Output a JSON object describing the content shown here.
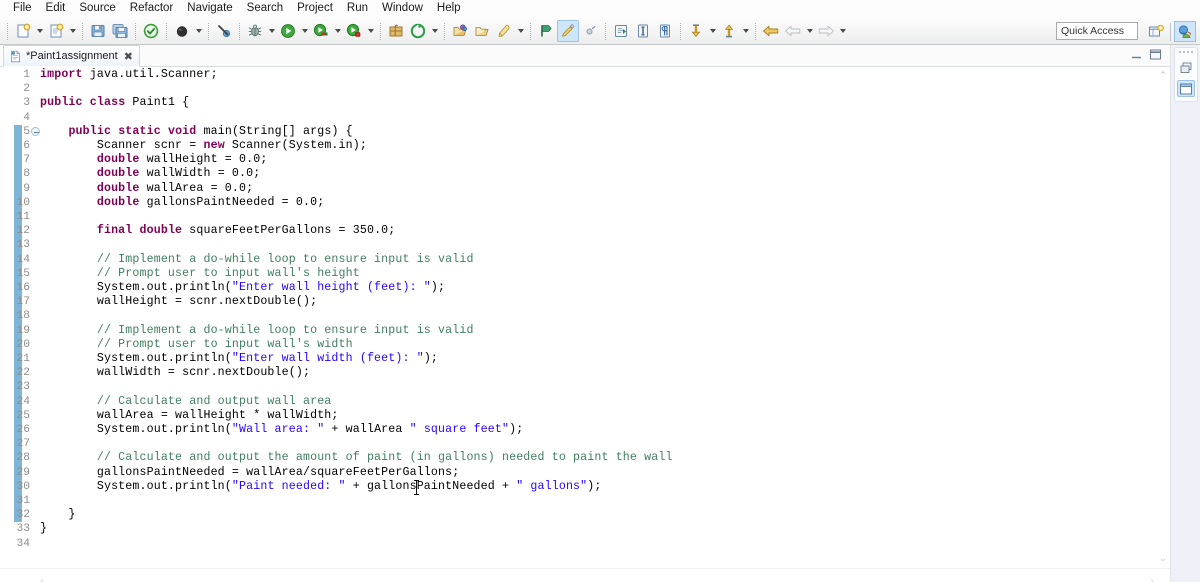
{
  "menu": {
    "items": [
      {
        "label": "File"
      },
      {
        "label": "Edit"
      },
      {
        "label": "Source"
      },
      {
        "label": "Refactor"
      },
      {
        "label": "Navigate"
      },
      {
        "label": "Search"
      },
      {
        "label": "Project"
      },
      {
        "label": "Run"
      },
      {
        "label": "Window"
      },
      {
        "label": "Help"
      }
    ]
  },
  "toolbar": {
    "quick_access_placeholder": "Quick Access",
    "buttons": [
      {
        "name": "new-file-icon",
        "tooltip": "New"
      },
      {
        "name": "new-java-class-icon",
        "tooltip": "New Java Class"
      },
      {
        "name": "save-icon",
        "tooltip": "Save"
      },
      {
        "name": "save-all-icon",
        "tooltip": "Save All"
      },
      {
        "name": "validate-icon",
        "tooltip": "Validate"
      },
      {
        "name": "external-tools-icon",
        "tooltip": "External Tools"
      },
      {
        "name": "skip-breakpoints-icon",
        "tooltip": "Skip All Breakpoints"
      },
      {
        "name": "debug-icon",
        "tooltip": "Debug"
      },
      {
        "name": "run-icon",
        "tooltip": "Run"
      },
      {
        "name": "coverage-icon",
        "tooltip": "Coverage"
      },
      {
        "name": "profile-icon",
        "tooltip": "Profile"
      },
      {
        "name": "new-package-icon",
        "tooltip": "New Java Package"
      },
      {
        "name": "open-type-icon",
        "tooltip": "Open Type"
      },
      {
        "name": "open-task-icon",
        "tooltip": "Open Task"
      },
      {
        "name": "open-resource-icon",
        "tooltip": "Open Resource"
      },
      {
        "name": "search-icon",
        "tooltip": "Search"
      },
      {
        "name": "previous-annotation-icon",
        "tooltip": "Previous Annotation"
      },
      {
        "name": "toggle-markoccurrences-icon",
        "tooltip": "Toggle Mark Occurrences"
      },
      {
        "name": "restore-icon",
        "tooltip": "Restore"
      },
      {
        "name": "next-edit-icon",
        "tooltip": "Next Edit"
      },
      {
        "name": "show-whitespace-icon",
        "tooltip": "Show Whitespace Characters"
      },
      {
        "name": "pilcrow-icon",
        "tooltip": "Block Selection Mode"
      },
      {
        "name": "next-annotation-icon",
        "tooltip": "Next Annotation"
      },
      {
        "name": "previous-annotation-up-icon",
        "tooltip": "Previous Annotation"
      },
      {
        "name": "last-edit-location-icon",
        "tooltip": "Last Edit Location"
      },
      {
        "name": "back-icon",
        "tooltip": "Back"
      },
      {
        "name": "forward-icon",
        "tooltip": "Forward"
      }
    ],
    "perspective": {
      "open_perspective": "open-perspective-icon",
      "java_perspective": "java-perspective-icon"
    }
  },
  "editor": {
    "tab": {
      "label": "*Paint1assignment",
      "close_glyph": "✖",
      "dirty": true
    },
    "view_controls": {
      "minimize": "minimize-icon",
      "maximize": "maximize-icon"
    },
    "scroll": {
      "up_glyph": "⌃",
      "down_glyph": "⌄",
      "left_glyph": "‹",
      "right_glyph": "›"
    },
    "change_bar": {
      "from_line": 5,
      "to_line": 32
    },
    "fold_markers": [
      5
    ],
    "mouse_cursor": {
      "line": 30,
      "column": 54,
      "type": "i-beam"
    },
    "lines": [
      {
        "n": 1,
        "text": "import java.util.Scanner;"
      },
      {
        "n": 2,
        "text": ""
      },
      {
        "n": 3,
        "text": "public class Paint1 {"
      },
      {
        "n": 4,
        "text": ""
      },
      {
        "n": 5,
        "text": "    public static void main(String[] args) {"
      },
      {
        "n": 6,
        "text": "        Scanner scnr = new Scanner(System.in);"
      },
      {
        "n": 7,
        "text": "        double wallHeight = 0.0;"
      },
      {
        "n": 8,
        "text": "        double wallWidth = 0.0;"
      },
      {
        "n": 9,
        "text": "        double wallArea = 0.0;"
      },
      {
        "n": 10,
        "text": "        double gallonsPaintNeeded = 0.0;"
      },
      {
        "n": 11,
        "text": ""
      },
      {
        "n": 12,
        "text": "        final double squareFeetPerGallons = 350.0;"
      },
      {
        "n": 13,
        "text": ""
      },
      {
        "n": 14,
        "text": "        // Implement a do-while loop to ensure input is valid"
      },
      {
        "n": 15,
        "text": "        // Prompt user to input wall's height"
      },
      {
        "n": 16,
        "text": "        System.out.println(\"Enter wall height (feet): \");"
      },
      {
        "n": 17,
        "text": "        wallHeight = scnr.nextDouble();"
      },
      {
        "n": 18,
        "text": ""
      },
      {
        "n": 19,
        "text": "        // Implement a do-while loop to ensure input is valid"
      },
      {
        "n": 20,
        "text": "        // Prompt user to input wall's width"
      },
      {
        "n": 21,
        "text": "        System.out.println(\"Enter wall width (feet): \");"
      },
      {
        "n": 22,
        "text": "        wallWidth = scnr.nextDouble();"
      },
      {
        "n": 23,
        "text": ""
      },
      {
        "n": 24,
        "text": "        // Calculate and output wall area"
      },
      {
        "n": 25,
        "text": "        wallArea = wallHeight * wallWidth;"
      },
      {
        "n": 26,
        "text": "        System.out.println(\"Wall area: \" + wallArea \" square feet\");"
      },
      {
        "n": 27,
        "text": ""
      },
      {
        "n": 28,
        "text": "        // Calculate and output the amount of paint (in gallons) needed to paint the wall"
      },
      {
        "n": 29,
        "text": "        gallonsPaintNeeded = wallArea/squareFeetPerGallons;"
      },
      {
        "n": 30,
        "text": "        System.out.println(\"Paint needed: \" + gallonsPaintNeeded + \" gallons\");"
      },
      {
        "n": 31,
        "text": ""
      },
      {
        "n": 32,
        "text": "    }"
      },
      {
        "n": 33,
        "text": "}"
      },
      {
        "n": 34,
        "text": ""
      }
    ]
  },
  "right_bar": {
    "restore_icon": "restore-view-icon",
    "java_view_icon": "java-editor-view-icon"
  },
  "colors": {
    "keyword": "#7f0055",
    "comment": "#3f7f5f",
    "string": "#2a00ff",
    "change_bar": "#7db4d8",
    "selection": "#cfe6fa",
    "toolbar_bg": "#f4f4f4"
  }
}
